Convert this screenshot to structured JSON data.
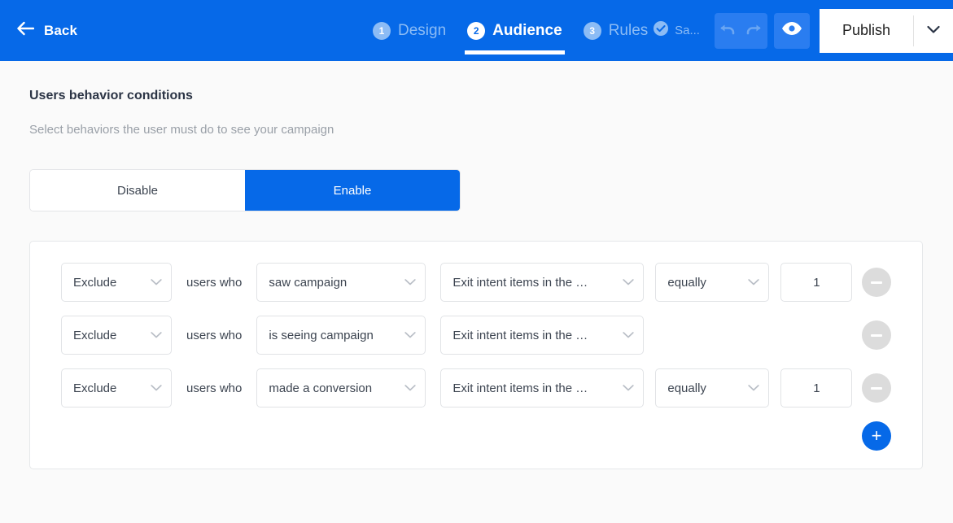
{
  "header": {
    "back_label": "Back",
    "back_icon": "arrow-left-icon",
    "steps": [
      {
        "number": "1",
        "label": "Design",
        "active": false
      },
      {
        "number": "2",
        "label": "Audience",
        "active": true
      },
      {
        "number": "3",
        "label": "Rules",
        "active": false
      }
    ],
    "saved_status": "Sa...",
    "saved_icon": "check-circle-icon",
    "undo_icon": "undo-arrow-icon",
    "redo_icon": "redo-arrow-icon",
    "preview_icon": "eye-icon",
    "publish_label": "Publish",
    "publish_caret_icon": "chevron-down-icon",
    "accent_color": "#0669e8",
    "inactive_step_color": "#8cbcf5"
  },
  "main": {
    "title": "Users behavior conditions",
    "subtitle": "Select behaviors the user must do to see your campaign",
    "toggle": {
      "options": [
        {
          "label": "Disable",
          "active": false
        },
        {
          "label": "Enable",
          "active": true
        }
      ]
    },
    "conditions": {
      "mid_label": "users who",
      "rows": [
        {
          "action": "Exclude",
          "event": "saw campaign",
          "target": "Exit intent items in the …",
          "comparator": "equally",
          "value": "1",
          "has_comparator": true
        },
        {
          "action": "Exclude",
          "event": "is seeing campaign",
          "target": "Exit intent items in the …",
          "comparator": "",
          "value": "",
          "has_comparator": false
        },
        {
          "action": "Exclude",
          "event": "made a conversion",
          "target": "Exit intent items in the …",
          "comparator": "equally",
          "value": "1",
          "has_comparator": true
        }
      ],
      "remove_icon": "minus-circle-icon",
      "add_icon": "plus-circle-icon",
      "add_label": "+"
    }
  }
}
